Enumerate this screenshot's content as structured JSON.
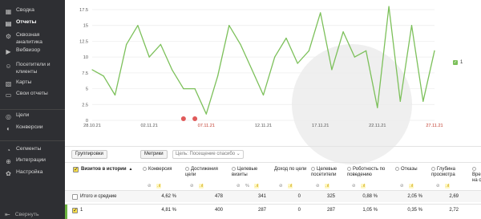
{
  "sidebar": {
    "items": [
      {
        "label": "Сводка",
        "icon": "grid-icon",
        "glyph": "▦",
        "active": false
      },
      {
        "label": "Отчеты",
        "icon": "reports-icon",
        "glyph": "▤",
        "active": true
      },
      {
        "label": "Сквозная аналитика",
        "icon": "analytics-icon",
        "glyph": "⚙",
        "active": false
      },
      {
        "label": "Вебвизор",
        "icon": "webvisor-icon",
        "glyph": "▶",
        "active": false
      },
      {
        "label": "Посетители и клиенты",
        "icon": "visitors-icon",
        "glyph": "☺",
        "active": false
      },
      {
        "label": "Карты",
        "icon": "maps-icon",
        "glyph": "▧",
        "active": false
      },
      {
        "label": "Свои отчеты",
        "icon": "custom-reports-icon",
        "glyph": "▭",
        "active": false
      },
      {
        "label": "Цели",
        "icon": "goals-icon",
        "glyph": "◎",
        "active": false
      },
      {
        "label": "Конверсии",
        "icon": "conversions-icon",
        "glyph": "◐",
        "active": false
      },
      {
        "label": "Сегменты",
        "icon": "segments-icon",
        "glyph": "◔",
        "active": false
      },
      {
        "label": "Интеграции",
        "icon": "integrations-icon",
        "glyph": "⊕",
        "active": false
      },
      {
        "label": "Настройка",
        "icon": "settings-icon",
        "glyph": "✿",
        "active": false
      }
    ],
    "collapse_label": "Свернуть"
  },
  "chart_data": {
    "type": "line",
    "ylim": [
      0,
      17.5
    ],
    "yticks": [
      "0",
      "2.5",
      "5",
      "7.5",
      "10",
      "12.5",
      "15",
      "17.5"
    ],
    "xtick_labels": [
      {
        "label": "28.10.21",
        "index": 0,
        "weekend": false
      },
      {
        "label": "02.11.21",
        "index": 5,
        "weekend": false
      },
      {
        "label": "07.11.21",
        "index": 10,
        "weekend": true
      },
      {
        "label": "12.11.21",
        "index": 15,
        "weekend": false
      },
      {
        "label": "17.11.21",
        "index": 20,
        "weekend": false
      },
      {
        "label": "22.11.21",
        "index": 25,
        "weekend": false
      },
      {
        "label": "27.11.21",
        "index": 30,
        "weekend": true
      }
    ],
    "series": [
      {
        "name": "1",
        "color": "#7cc05a",
        "values": [
          8,
          7,
          4,
          12,
          15,
          10,
          12,
          8,
          5,
          5,
          1,
          7,
          15,
          12,
          8,
          4,
          10,
          13,
          9,
          11,
          17,
          8,
          14,
          10,
          11,
          2,
          18,
          3,
          15,
          3,
          11
        ]
      }
    ],
    "legend": "right",
    "markers": [
      {
        "index": 8,
        "color": "#e05a5a"
      },
      {
        "index": 9,
        "color": "#e05a5a"
      }
    ]
  },
  "toolbar": {
    "grouping_label": "Группировки",
    "metrics_label": "Метрики",
    "goal_select": "Цель: Посещение спасибо"
  },
  "table": {
    "dimension_header": "Визитов в истории",
    "sort_icon": "▲",
    "columns": [
      {
        "label": "Конверсия",
        "radio": true,
        "subs": [
          "⊘",
          ".ıl"
        ]
      },
      {
        "label": "Достижения цели",
        "radio": true,
        "subs": [
          "⊘",
          ".ıl"
        ]
      },
      {
        "label": "Целевые визиты",
        "radio": true,
        "subs": [
          "⊘",
          "%",
          ".ıl"
        ]
      },
      {
        "label": "Доход по цели",
        "radio": false,
        "subs": [
          "⊘",
          ".ıl"
        ]
      },
      {
        "label": "Целевые посетители",
        "radio": true,
        "subs": [
          "⊘",
          ".ıl"
        ]
      },
      {
        "label": "Роботность по поведению",
        "radio": true,
        "subs": [
          "⊘",
          ".ıl"
        ]
      },
      {
        "label": "Отказы",
        "radio": true,
        "subs": [
          "⊘",
          ".ıl"
        ]
      },
      {
        "label": "Глубина просмотра",
        "radio": true,
        "subs": [
          "⊘",
          ".ıl"
        ]
      },
      {
        "label": "Врем на сай",
        "radio": true,
        "subs": []
      }
    ],
    "rows": [
      {
        "label": "Итого и средние",
        "checked": false,
        "values": [
          "4,62 %",
          "478",
          "341",
          "0",
          "325",
          "0,88 %",
          "2,05 %",
          "2,69"
        ]
      },
      {
        "label": "1",
        "checked": true,
        "values": [
          "4,81 %",
          "400",
          "287",
          "0",
          "287",
          "1,05 %",
          "0,35 %",
          "2,72"
        ]
      }
    ]
  }
}
